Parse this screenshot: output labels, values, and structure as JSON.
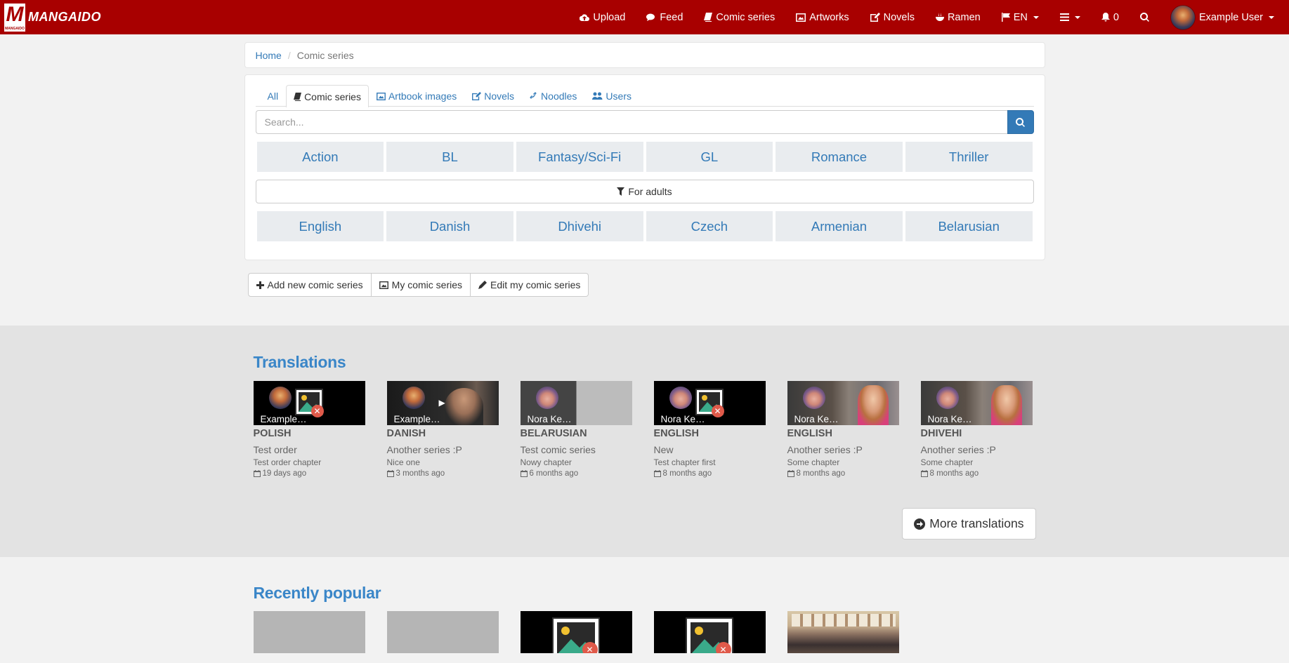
{
  "brand": {
    "logo_letter": "M",
    "logo_small": "MANGAIDO",
    "name": "MANGAIDO"
  },
  "nav": {
    "items": [
      {
        "icon": "cloud-upload-icon",
        "label": "Upload"
      },
      {
        "icon": "comments-icon",
        "label": "Feed"
      },
      {
        "icon": "book-icon",
        "label": "Comic series"
      },
      {
        "icon": "picture-icon",
        "label": "Artworks"
      },
      {
        "icon": "edit-icon",
        "label": "Novels"
      },
      {
        "icon": "bowl-icon",
        "label": "Ramen"
      }
    ],
    "language": "EN",
    "notifications": "0",
    "user": "Example User"
  },
  "breadcrumb": {
    "home": "Home",
    "current": "Comic series"
  },
  "tabs": [
    "All",
    "Comic series",
    "Artbook images",
    "Novels",
    "Noodles",
    "Users"
  ],
  "active_tab": "Comic series",
  "search": {
    "placeholder": "Search..."
  },
  "genres": [
    "Action",
    "BL",
    "Fantasy/Sci-Fi",
    "GL",
    "Romance",
    "Thriller"
  ],
  "adult_filter": "For adults",
  "languages": [
    "English",
    "Danish",
    "Dhivehi",
    "Czech",
    "Armenian",
    "Belarusian"
  ],
  "actions": {
    "add": "Add new comic series",
    "mine": "My comic series",
    "edit": "Edit my comic series"
  },
  "translations": {
    "title": "Translations",
    "items": [
      {
        "user": "Example…",
        "lang": "POLISH",
        "series": "Test order",
        "chapter": "Test order chapter",
        "ago": "19 days ago"
      },
      {
        "user": "Example…",
        "lang": "DANISH",
        "series": "Another series :P",
        "chapter": "Nice one",
        "ago": "3 months ago"
      },
      {
        "user": "Nora Ke…",
        "lang": "BELARUSIAN",
        "series": "Test comic series",
        "chapter": "Nowy chapter",
        "ago": "6 months ago"
      },
      {
        "user": "Nora Ke…",
        "lang": "ENGLISH",
        "series": "New",
        "chapter": "Test chapter first",
        "ago": "8 months ago"
      },
      {
        "user": "Nora Ke…",
        "lang": "ENGLISH",
        "series": "Another series :P",
        "chapter": "Some chapter",
        "ago": "8 months ago"
      },
      {
        "user": "Nora Ke…",
        "lang": "DHIVEHI",
        "series": "Another series :P",
        "chapter": "Some chapter",
        "ago": "8 months ago"
      }
    ],
    "more": "More translations"
  },
  "popular": {
    "title": "Recently popular"
  },
  "colors": {
    "brand_red": "#a80000",
    "link_blue": "#337ab7",
    "title_blue": "#3a86c8"
  }
}
